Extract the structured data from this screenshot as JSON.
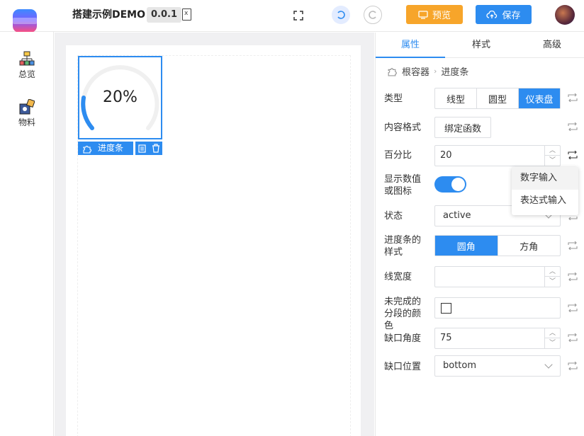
{
  "header": {
    "app_title": "搭建示例DEMO",
    "version": "0.0.1",
    "preview_label": "预览",
    "save_label": "保存"
  },
  "leftnav": {
    "items": [
      {
        "label": "总览",
        "icon": "sitemap-icon"
      },
      {
        "label": "物料",
        "icon": "puzzle-icon"
      }
    ]
  },
  "canvas": {
    "progress_text": "20%",
    "component_label": "进度条"
  },
  "panel": {
    "tabs": [
      "属性",
      "样式",
      "高级"
    ],
    "breadcrumb": [
      "根容器",
      "进度条"
    ],
    "fields": {
      "type": {
        "label": "类型",
        "options": [
          "线型",
          "圆型",
          "仪表盘"
        ],
        "selected": "仪表盘"
      },
      "content_format": {
        "label": "内容格式",
        "button": "绑定函数"
      },
      "percent": {
        "label": "百分比",
        "value": "20"
      },
      "show_info": {
        "label": "显示数值或图标",
        "on": true
      },
      "status": {
        "label": "状态",
        "value": "active"
      },
      "stroke_linecap": {
        "label": "进度条的样式",
        "options": [
          "圆角",
          "方角"
        ],
        "selected": "圆角"
      },
      "stroke_width": {
        "label": "线宽度",
        "value": ""
      },
      "trail_color": {
        "label": "未完成的分段的颜色"
      },
      "gap_degree": {
        "label": "缺口角度",
        "value": "75"
      },
      "gap_position": {
        "label": "缺口位置",
        "value": "bottom"
      }
    },
    "dropdown": [
      "数字输入",
      "表达式输入"
    ]
  },
  "colors": {
    "primary": "#2d8cf0",
    "orange": "#f7a52a"
  }
}
